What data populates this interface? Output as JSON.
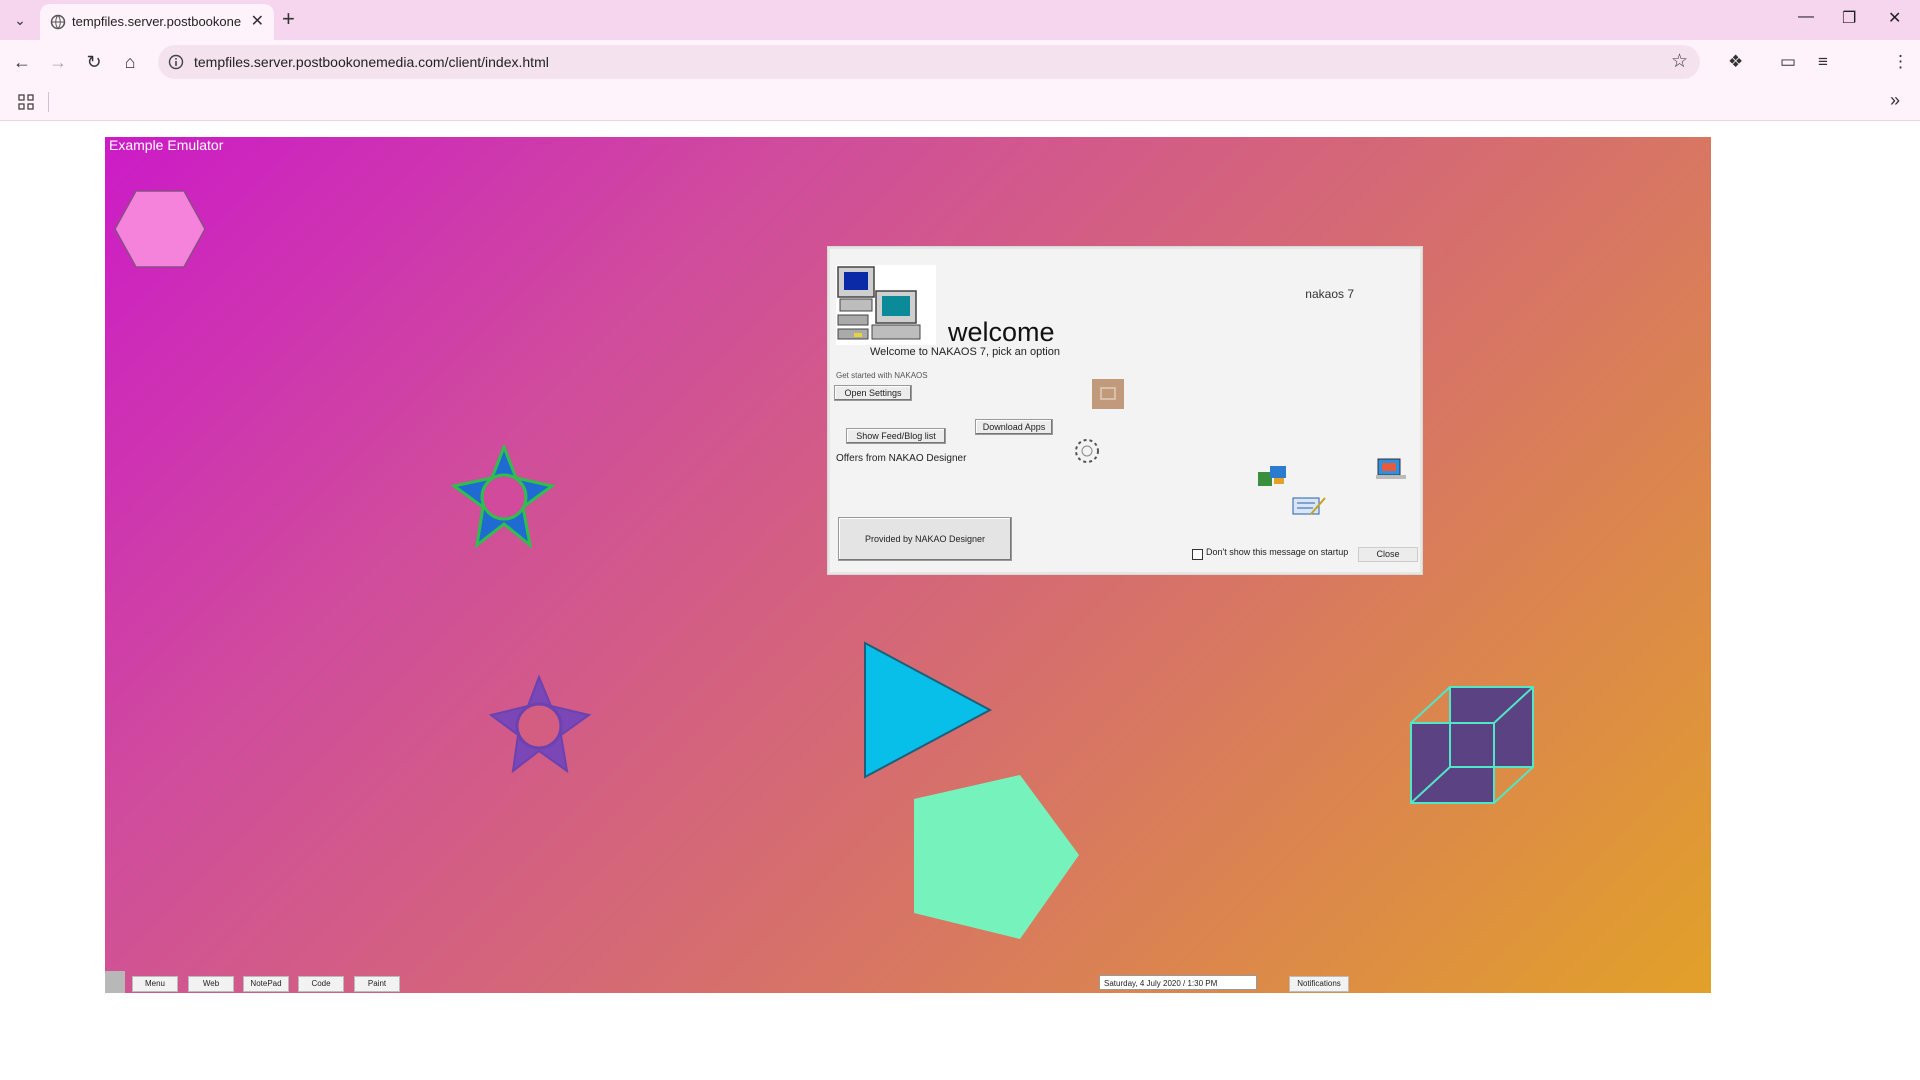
{
  "browser": {
    "tab_title": "tempfiles.server.postbookonemedia.com",
    "url": "tempfiles.server.postbookonemedia.com/client/index.html"
  },
  "emulator": {
    "title": "Example Emulator",
    "dialog": {
      "welcome": "welcome",
      "version": "nakaos 7",
      "subtitle": "Welcome to NAKAOS 7, pick an option",
      "small_note": "Get started with NAKAOS",
      "open_settings": "Open Settings",
      "download_apps": "Download Apps",
      "show_feeds": "Show Feed/Blog list",
      "offers": "Offers from NAKAO Designer",
      "provider_button": "Provided by NAKAO Designer",
      "dont_show": "Don't show this message on startup",
      "close": "Close"
    },
    "taskbar": {
      "buttons": [
        "Menu",
        "Web",
        "NotePad",
        "Code",
        "Paint"
      ],
      "clock": "Saturday, 4 July 2020 / 1:30 PM",
      "notifications": "Notifications"
    }
  },
  "colors": {
    "hexagon": "#f583dc",
    "star_blue": "#1f6bd1",
    "star_purple": "#7b46b5",
    "triangle": "#07bfe8",
    "pentagon": "#76f3bd",
    "cube": "#5b4282"
  }
}
